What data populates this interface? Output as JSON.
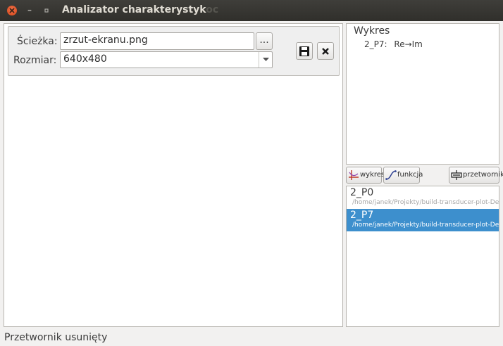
{
  "window": {
    "title": "Analizator charakterystyk",
    "title_overflow": "oc"
  },
  "save_panel": {
    "path_label": "Ścieżka:",
    "path_value": "zrzut-ekranu.png",
    "browse_label": "...",
    "size_label": "Rozmiar:",
    "size_value": "640x480",
    "save_icon": "floppy-disk-icon",
    "close_icon": "close-icon"
  },
  "chart_tree": {
    "root": "Wykres",
    "child_id": "2_P7:",
    "child_value": "Re→Im"
  },
  "toolbar": {
    "chart_label": "wykres",
    "function_label": "funkcja",
    "transducer_label": "przetwornik"
  },
  "transducers": [
    {
      "name": "2_P0",
      "path": "/home/janek/Projekty/build-transducer-plot-Desktop",
      "selected": false
    },
    {
      "name": "2_P7",
      "path": "/home/janek/Projekty/build-transducer-plot-Desktop",
      "selected": true
    }
  ],
  "status": {
    "message": "Przetwornik usunięty"
  },
  "colors": {
    "selection": "#3d8fcd",
    "titlebar": "#3a3935",
    "close_button": "#e95420"
  }
}
